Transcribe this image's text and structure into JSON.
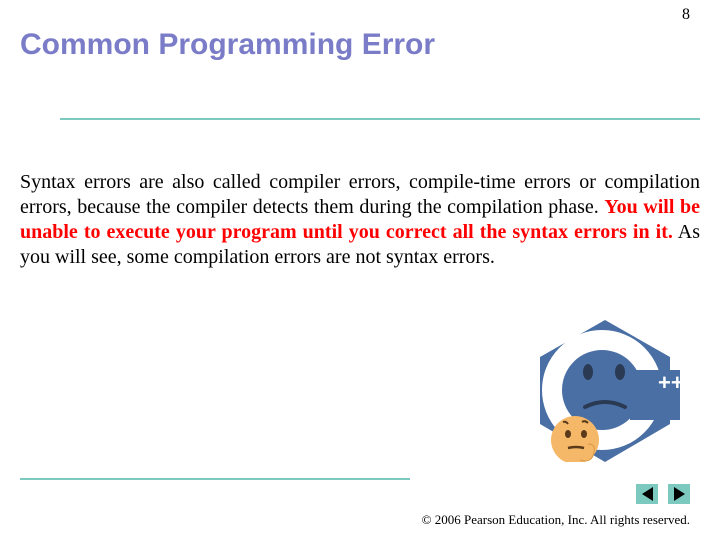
{
  "page_number": "8",
  "title": "Common Programming Error",
  "body": {
    "before": "Syntax errors are also called compiler errors, compile-time errors or compilation errors, because the compiler detects them during the compilation phase. ",
    "emphasis": "You will be unable to execute your program until you correct all the syntax errors in it.",
    "after": " As you will see, some compilation errors are not syntax errors."
  },
  "illustration": {
    "label": "C++ thinking emoji",
    "badge": "++"
  },
  "copyright": "© 2006 Pearson Education, Inc.  All rights reserved.",
  "nav": {
    "prev": "previous",
    "next": "next"
  },
  "colors": {
    "title": "#7a7cc8",
    "accent": "#7cc9c0",
    "emphasis": "#ff0000"
  }
}
